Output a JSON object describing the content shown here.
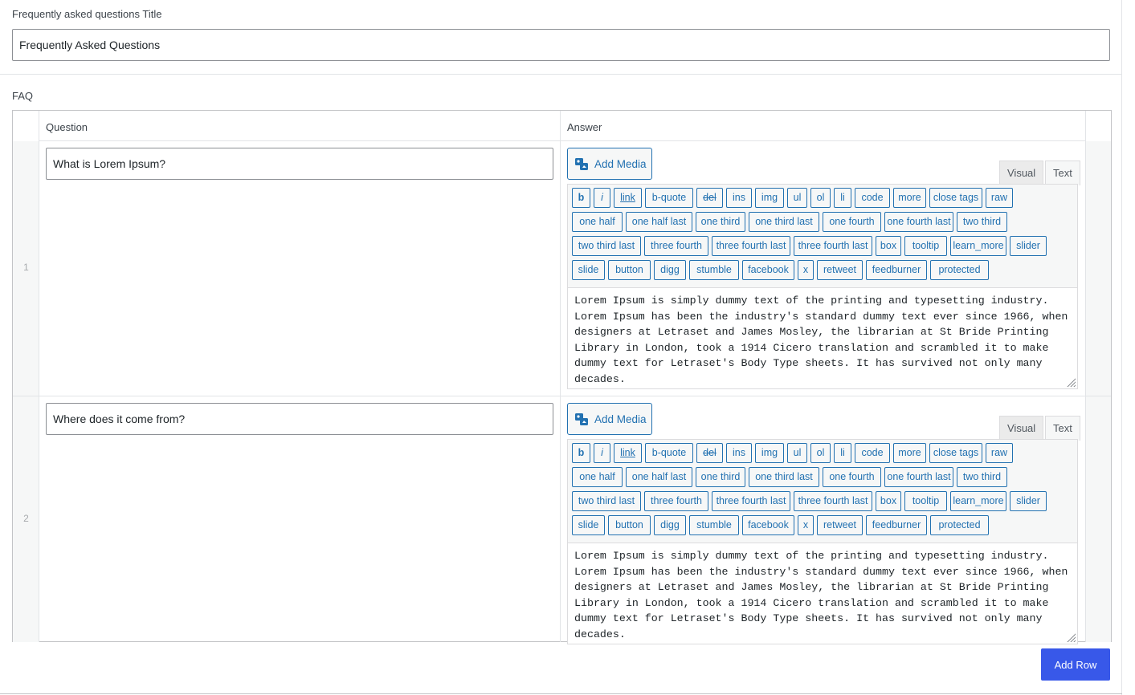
{
  "faq_title": {
    "label": "Frequently asked questions Title",
    "value": "Frequently Asked Questions"
  },
  "faq": {
    "label": "FAQ",
    "columns": {
      "question": "Question",
      "answer": "Answer"
    },
    "editor": {
      "add_media_label": "Add Media",
      "tab_visual": "Visual",
      "tab_text": "Text",
      "quicktags": [
        [
          "b",
          "i",
          "link",
          "b-quote",
          "del",
          "ins",
          "img",
          "ul",
          "ol",
          "li",
          "code",
          "more",
          "close tags",
          "raw"
        ],
        [
          "one half",
          "one half last",
          "one third",
          "one third last",
          "one fourth",
          "one fourth last",
          "two third"
        ],
        [
          "two third last",
          "three fourth",
          "three fourth last",
          "three fourth last",
          "box",
          "tooltip",
          "learn_more",
          "slider"
        ],
        [
          "slide",
          "button",
          "digg",
          "stumble",
          "facebook",
          "x",
          "retweet",
          "feedburner",
          "protected"
        ]
      ]
    },
    "rows": [
      {
        "number": "1",
        "question": "What is Lorem Ipsum?",
        "answer": "Lorem Ipsum is simply dummy text of the printing and typesetting industry. Lorem Ipsum has been the industry's standard dummy text ever since 1966, when designers at Letraset and James Mosley, the librarian at St Bride Printing Library in London, took a 1914 Cicero translation and scrambled it to make dummy text for Letraset's Body Type sheets. It has survived not only many decades."
      },
      {
        "number": "2",
        "question": "Where does it come from?",
        "answer": "Lorem Ipsum is simply dummy text of the printing and typesetting industry. Lorem Ipsum has been the industry's standard dummy text ever since 1966, when designers at Letraset and James Mosley, the librarian at St Bride Printing Library in London, took a 1914 Cicero translation and scrambled it to make dummy text for Letraset's Body Type sheets. It has survived not only many decades."
      }
    ],
    "add_row_label": "Add Row"
  },
  "colors": {
    "accent": "#2271b1",
    "primary_button": "#3858e9"
  }
}
